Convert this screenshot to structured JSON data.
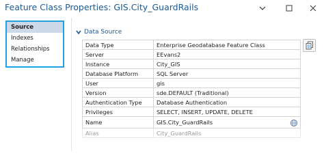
{
  "window": {
    "title": "Feature Class Properties: GIS.City_GuardRails"
  },
  "nav": {
    "items": [
      {
        "label": "Source",
        "active": true
      },
      {
        "label": "Indexes",
        "active": false
      },
      {
        "label": "Relationships",
        "active": false
      },
      {
        "label": "Manage",
        "active": false
      }
    ]
  },
  "section": {
    "title": "Data Source"
  },
  "properties": [
    {
      "key": "Data Type",
      "value": "Enterprise Geodatabase Feature Class"
    },
    {
      "key": "Server",
      "value": "EEvans2"
    },
    {
      "key": "Instance",
      "value": "City_GIS"
    },
    {
      "key": "Database Platform",
      "value": "SQL Server"
    },
    {
      "key": "User",
      "value": "gis"
    },
    {
      "key": "Version",
      "value": "sde.DEFAULT (Traditional)"
    },
    {
      "key": "Authentication Type",
      "value": "Database Authentication"
    },
    {
      "key": "Privileges",
      "value": "SELECT, INSERT, UPDATE, DELETE"
    },
    {
      "key": "Name",
      "value": "GIS.City_GuardRails"
    },
    {
      "key": "Alias",
      "value": "City_GuardRails"
    }
  ],
  "colors": {
    "accent": "#21a0df",
    "title": "#1c5a94",
    "active_nav_bg": "#ccd9e8"
  },
  "icons": {
    "menu": "chevron-down-icon",
    "maximize": "maximize-icon",
    "close": "close-icon",
    "section_toggle": "chevron-down-icon",
    "copy": "copy-icon",
    "name_field": "globe-icon"
  }
}
